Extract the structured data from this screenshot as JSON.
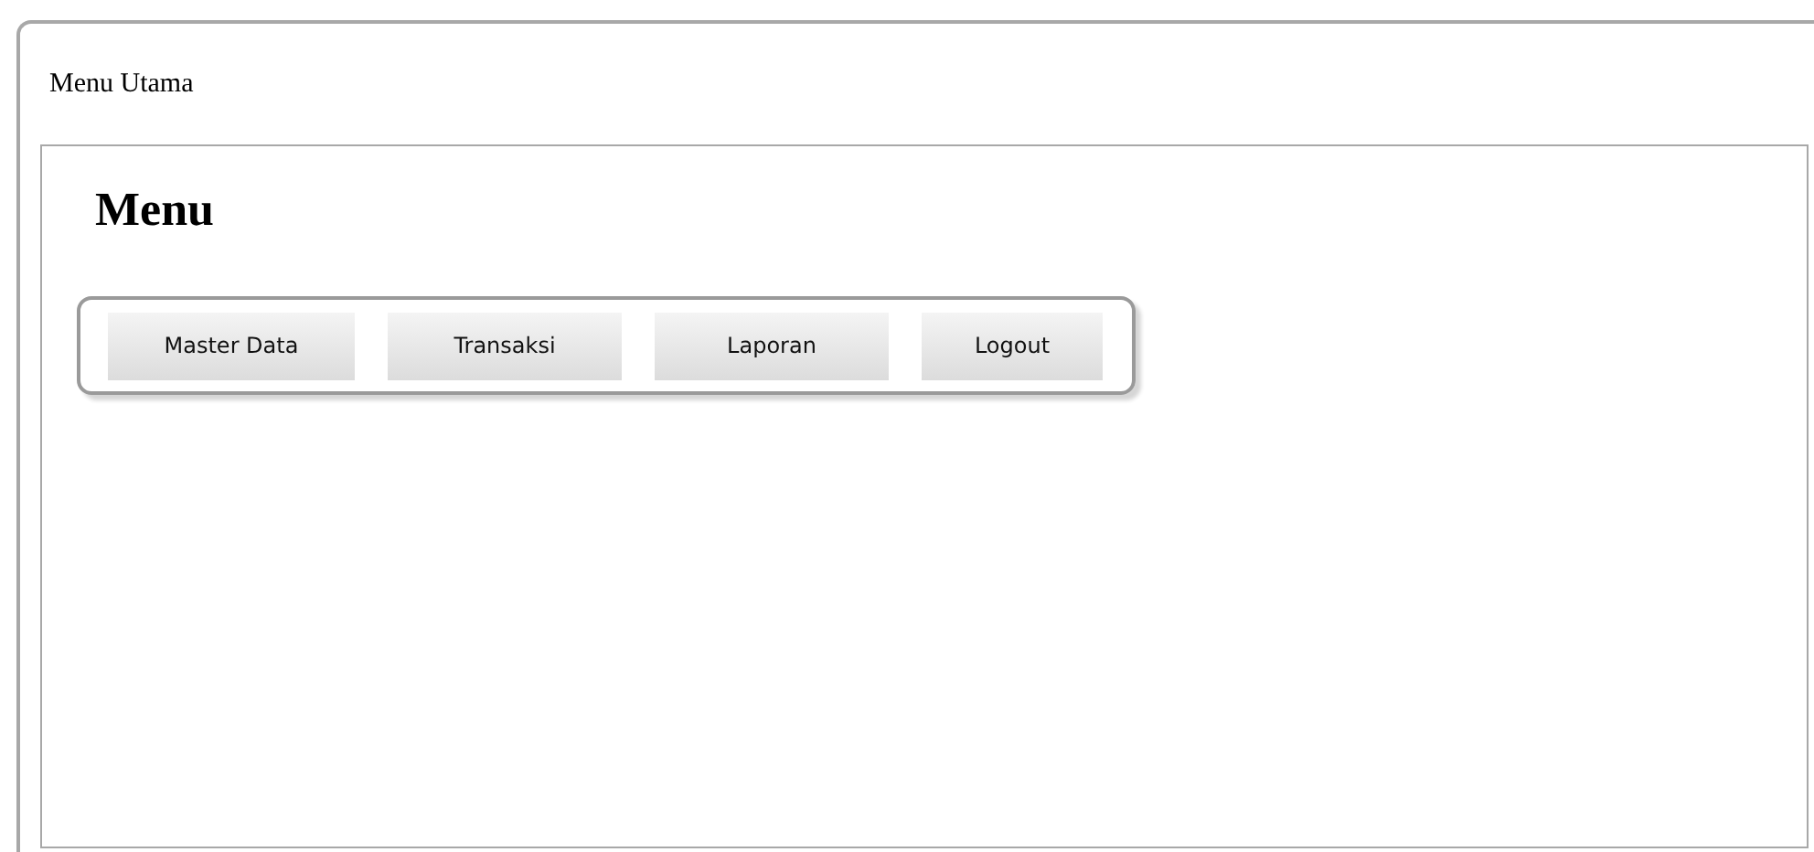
{
  "window": {
    "title": "Menu Utama"
  },
  "panel": {
    "heading": "Menu",
    "buttons": [
      {
        "label": "Master Data"
      },
      {
        "label": "Transaksi"
      },
      {
        "label": "Laporan"
      },
      {
        "label": "Logout"
      }
    ]
  }
}
